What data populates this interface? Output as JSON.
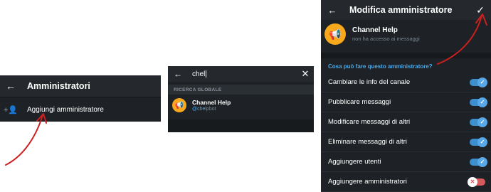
{
  "panel1": {
    "title": "Amministratori",
    "add_label": "Aggiungi amministratore"
  },
  "panel2": {
    "query": "chel",
    "section": "RICERCA GLOBALE",
    "result": {
      "name": "Channel Help",
      "username_prefix": "@",
      "username_match": "chel",
      "username_rest": "pbot"
    }
  },
  "panel3": {
    "title": "Modifica amministratore",
    "bot_name": "Channel Help",
    "bot_status": "non ha accesso ai messaggi",
    "question": "Cosa può fare questo amministratore?",
    "permissions": [
      {
        "label": "Cambiare le info del canale",
        "enabled": true
      },
      {
        "label": "Pubblicare messaggi",
        "enabled": true
      },
      {
        "label": "Modificare messaggi di altri",
        "enabled": true
      },
      {
        "label": "Eliminare messaggi di altri",
        "enabled": true
      },
      {
        "label": "Aggiungere utenti",
        "enabled": true
      },
      {
        "label": "Aggiungere amministratori",
        "enabled": false
      }
    ]
  },
  "colors": {
    "accent": "#4aa8e8",
    "avatar": "#f7a81b",
    "annotation": "#cc1f1f"
  },
  "icons": [
    "back-arrow-icon",
    "add-person-icon",
    "close-icon",
    "megaphone-icon",
    "check-icon"
  ]
}
